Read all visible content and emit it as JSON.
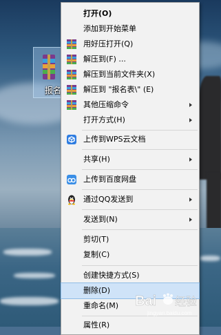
{
  "desktop_icon": {
    "label": "报名"
  },
  "context_menu": {
    "items": [
      {
        "label": "打开(O)"
      },
      {
        "label": "添加到开始菜单"
      },
      {
        "label": "用好压打开(Q)",
        "icon": "haozip-icon"
      },
      {
        "label": "解压到(F) ...",
        "icon": "haozip-icon"
      },
      {
        "label": "解压到当前文件夹(X)",
        "icon": "haozip-icon"
      },
      {
        "label": "解压到 \"报名表\\\" (E)",
        "icon": "haozip-icon"
      },
      {
        "label": "其他压缩命令",
        "icon": "haozip-icon"
      },
      {
        "label": "打开方式(H)"
      },
      {
        "label": "上传到WPS云文档",
        "icon": "wps-cloud-icon"
      },
      {
        "label": "共享(H)"
      },
      {
        "label": "上传到百度网盘",
        "icon": "baidu-netdisk-icon"
      },
      {
        "label": "通过QQ发送到",
        "icon": "qq-penguin-icon"
      },
      {
        "label": "发送到(N)"
      },
      {
        "label": "剪切(T)"
      },
      {
        "label": "复制(C)"
      },
      {
        "label": "创建快捷方式(S)"
      },
      {
        "label": "删除(D)"
      },
      {
        "label": "重命名(M)"
      },
      {
        "label": "属性(R)"
      }
    ]
  },
  "watermark": {
    "text": "Bai 经验",
    "sub": "jingyan.baidu.com"
  },
  "colors": {
    "menu_bg": "#f2f2f2",
    "highlight": "#cfe3f8",
    "highlight_border": "#8fbce6"
  }
}
